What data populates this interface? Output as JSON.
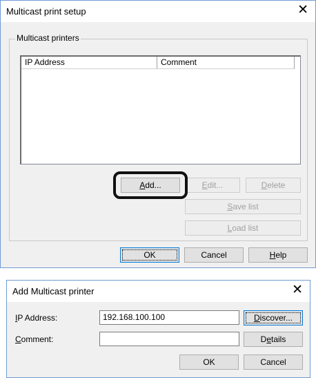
{
  "setup_dialog": {
    "title": "Multicast print setup",
    "close_glyph": "✕",
    "group_label": "Multicast printers",
    "columns": [
      "IP Address",
      "Comment"
    ],
    "rows": [],
    "buttons": {
      "add": {
        "label": "Add...",
        "mnemonic": "A",
        "rest": "dd..."
      },
      "edit": {
        "label": "Edit...",
        "mnemonic": "E",
        "rest": "dit..."
      },
      "delete": {
        "label": "Delete",
        "mnemonic": "D",
        "rest": "elete"
      },
      "save_list": {
        "label": "Save list",
        "mnemonic": "S",
        "rest": "ave list"
      },
      "load_list": {
        "label": "Load list",
        "mnemonic": "L",
        "rest": "oad list"
      },
      "ok": {
        "label": "OK"
      },
      "cancel": {
        "label": "Cancel"
      },
      "help": {
        "label": "Help",
        "mnemonic": "H",
        "rest": "elp"
      }
    }
  },
  "add_dialog": {
    "title": "Add Multicast printer",
    "close_glyph": "✕",
    "ip_label": {
      "label": "IP Address:",
      "mnemonic": "I",
      "rest": "P Address:"
    },
    "ip_value": "192.168.100.100",
    "comment_label": {
      "label": "Comment:",
      "mnemonic": "C",
      "rest": "omment:"
    },
    "comment_value": "",
    "buttons": {
      "discover": {
        "label": "Discover...",
        "mnemonic": "D",
        "rest": "iscover..."
      },
      "details": {
        "label": "Details",
        "pre": "D",
        "mnemonic": "e",
        "rest": "tails"
      },
      "ok": {
        "label": "OK"
      },
      "cancel": {
        "label": "Cancel"
      }
    }
  },
  "colors": {
    "border_accent": "#6f9bd1",
    "dialog_bg": "#f0f0f0",
    "highlight_ring": "#111111"
  }
}
